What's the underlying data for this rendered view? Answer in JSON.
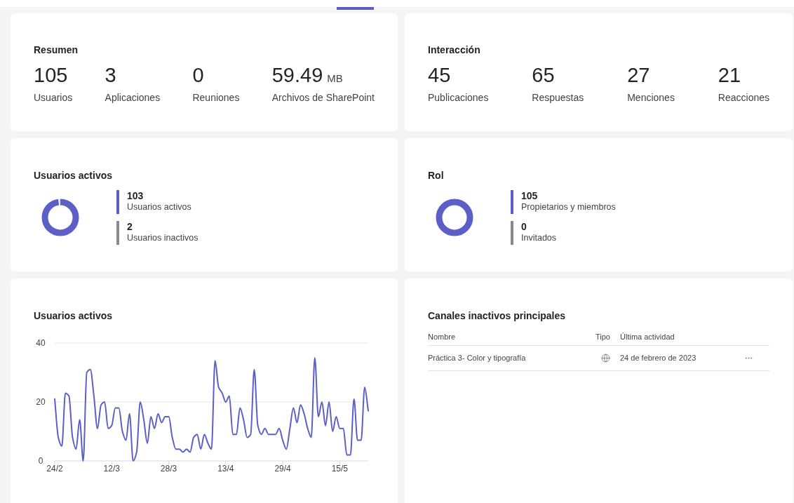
{
  "summary": {
    "title": "Resumen",
    "stats": [
      {
        "value": "105",
        "label": "Usuarios"
      },
      {
        "value": "3",
        "label": "Aplicaciones"
      },
      {
        "value": "0",
        "label": "Reuniones"
      },
      {
        "value": "59.49",
        "unit": "MB",
        "label": "Archivos de SharePoint"
      }
    ]
  },
  "interaction": {
    "title": "Interacción",
    "stats": [
      {
        "value": "45",
        "label": "Publicaciones"
      },
      {
        "value": "65",
        "label": "Respuestas"
      },
      {
        "value": "27",
        "label": "Menciones"
      },
      {
        "value": "21",
        "label": "Reacciones"
      }
    ]
  },
  "active_users": {
    "title": "Usuarios activos",
    "legend": [
      {
        "value": "103",
        "label": "Usuarios activos",
        "color": "#5b5fc7"
      },
      {
        "value": "2",
        "label": "Usuarios inactivos",
        "color": "#8a8a8a"
      }
    ]
  },
  "role": {
    "title": "Rol",
    "legend": [
      {
        "value": "105",
        "label": "Propietarios y miembros",
        "color": "#5b5fc7"
      },
      {
        "value": "0",
        "label": "Invitados",
        "color": "#8a8a8a"
      }
    ]
  },
  "active_users_chart": {
    "title": "Usuarios activos",
    "chart_data": {
      "type": "line",
      "ylim": [
        0,
        40
      ],
      "yticks": [
        0,
        20,
        40
      ],
      "categories": [
        "24/2",
        null,
        null,
        null,
        null,
        null,
        null,
        null,
        null,
        null,
        null,
        null,
        null,
        null,
        null,
        null,
        "12/3",
        null,
        null,
        null,
        null,
        null,
        null,
        null,
        null,
        null,
        null,
        null,
        null,
        null,
        null,
        null,
        "28/3",
        null,
        null,
        null,
        null,
        null,
        null,
        null,
        null,
        null,
        null,
        null,
        null,
        null,
        null,
        null,
        "13/4",
        null,
        null,
        null,
        null,
        null,
        null,
        null,
        null,
        null,
        null,
        null,
        null,
        null,
        null,
        null,
        "29/4",
        null,
        null,
        null,
        null,
        null,
        null,
        null,
        null,
        null,
        null,
        null,
        null,
        null,
        null,
        null,
        "15/5",
        null,
        null,
        null,
        null,
        null,
        null,
        null,
        null
      ],
      "series": [
        {
          "color": "#5b5fc7",
          "values": [
            21,
            8,
            5,
            23,
            22,
            8,
            4,
            14,
            0,
            30,
            31,
            22,
            11,
            19,
            20,
            11,
            12,
            18,
            18,
            10,
            7,
            16,
            0,
            3,
            20,
            14,
            6,
            15,
            11,
            16,
            13,
            15,
            15,
            8,
            4,
            4,
            3,
            4,
            3,
            8,
            9,
            4,
            9,
            6,
            4,
            34,
            25,
            23,
            20,
            22,
            9,
            9,
            18,
            14,
            8,
            9,
            31,
            12,
            9,
            11,
            9,
            9,
            9,
            11,
            7,
            4,
            11,
            18,
            13,
            19,
            16,
            11,
            8,
            35,
            15,
            20,
            12,
            20,
            10,
            15,
            11,
            11,
            2,
            2,
            21,
            7,
            7,
            25,
            17
          ]
        }
      ]
    }
  },
  "inactive_channels": {
    "title": "Canales inactivos principales",
    "columns": [
      "Nombre",
      "Tipo",
      "Última actividad"
    ],
    "rows": [
      {
        "name": "Práctica 3- Color y tipografía",
        "last_activity": "24 de febrero de 2023"
      }
    ]
  }
}
